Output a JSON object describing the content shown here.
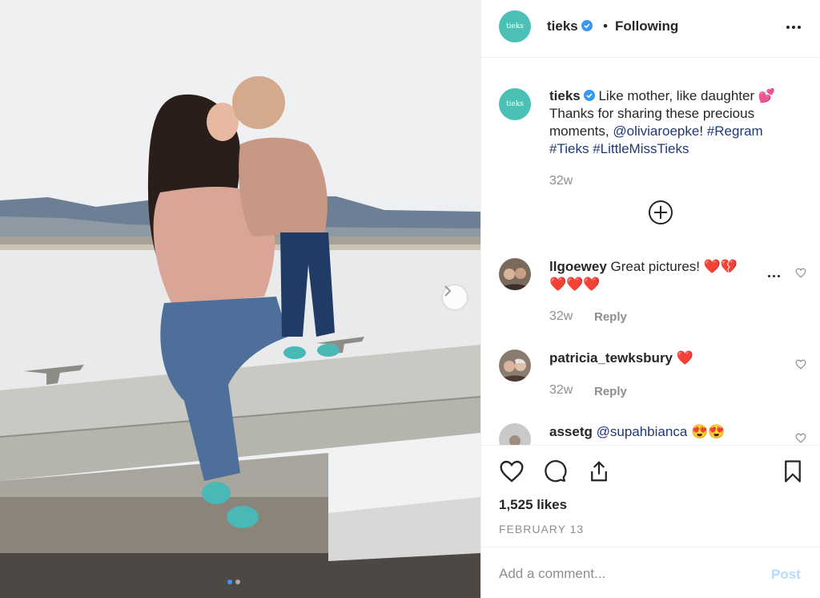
{
  "post": {
    "author": "tieks",
    "logo_text": "tieks",
    "follow_status": "Following",
    "separator": "•",
    "caption_line1": " Like mother, like daughter 💕",
    "caption_line2": "Thanks for sharing these precious",
    "caption_line3_prefix": "moments, ",
    "mention": "@oliviaroepke",
    "caption_line3_suffix": "! ",
    "hashtag_regram": "#Regram",
    "hashtag_tieks": "#Tieks",
    "hashtag_little": "#LittleMissTieks",
    "caption_time": "32w",
    "likes": "1,525 likes",
    "date": "FEBRUARY 13"
  },
  "comments": [
    {
      "user": "llgoewey",
      "text": " Great pictures! ❤️💔",
      "text2": "❤️❤️❤️",
      "time": "32w",
      "reply_label": "Reply"
    },
    {
      "user": "patricia_tewksbury",
      "text": " ❤️",
      "time": "32w",
      "reply_label": "Reply"
    },
    {
      "user": "assetg",
      "mention": "@supahbianca",
      "text": " 😍😍"
    }
  ],
  "add_comment": {
    "placeholder": "Add a comment...",
    "post_label": "Post"
  },
  "colors": {
    "accent": "#3897f0",
    "tieks_teal": "#4bc0b4",
    "link": "#1e3a7a"
  }
}
